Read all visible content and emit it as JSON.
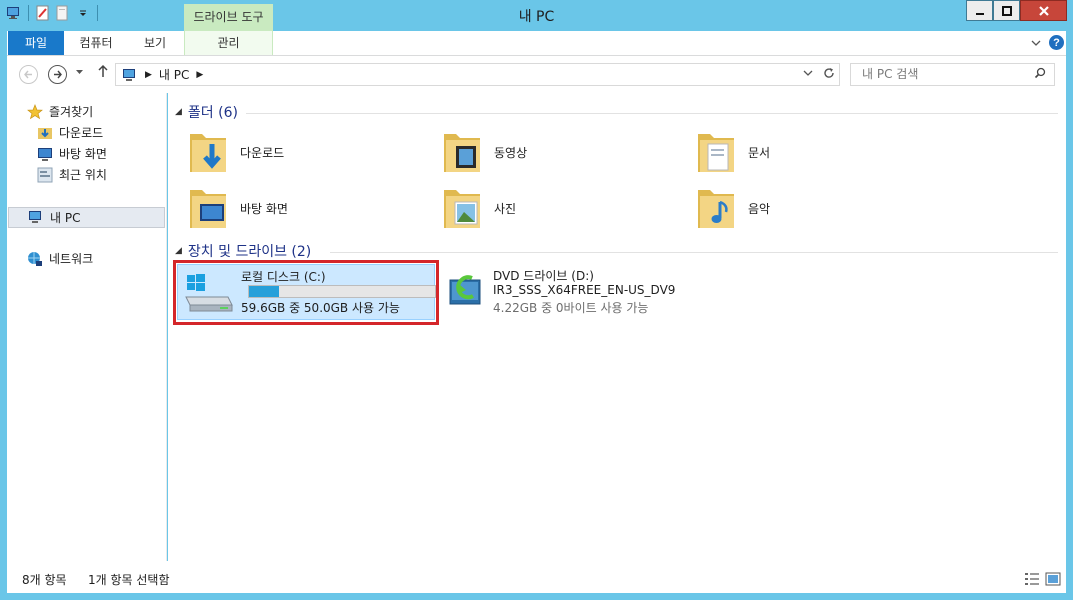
{
  "window": {
    "title": "내 PC",
    "context_tab_header": "드라이브 도구"
  },
  "ribbon": {
    "tabs": [
      "파일",
      "컴퓨터",
      "보기",
      "관리"
    ],
    "help_glyph": "?"
  },
  "address": {
    "crumb": "내 PC",
    "search_placeholder": "내 PC 검색"
  },
  "nav_pane": {
    "favorites_label": "즐겨찾기",
    "favorites": [
      "다운로드",
      "바탕 화면",
      "최근 위치"
    ],
    "this_pc": "내 PC",
    "network": "네트워크"
  },
  "folders_group": {
    "header": "폴더 (6)",
    "items": [
      "다운로드",
      "동영상",
      "문서",
      "바탕 화면",
      "사진",
      "음악"
    ]
  },
  "drives_group": {
    "header": "장치 및 드라이브 (2)",
    "local": {
      "name": "로컬 디스크 (C:)",
      "space": "59.6GB 중 50.0GB 사용 가능",
      "used_fraction": 0.16
    },
    "dvd": {
      "name": "DVD 드라이브 (D:)",
      "label": "IR3_SSS_X64FREE_EN-US_DV9",
      "space": "4.22GB 중 0바이트 사용 가능"
    }
  },
  "status": {
    "items": "8개 항목",
    "selected": "1개 항목 선택함"
  },
  "colors": {
    "frame": "#6ac6e8",
    "file_tab": "#1979ca",
    "context_tab": "#c9eac0",
    "selection": "#cce8ff",
    "highlight_box": "#d4262a",
    "group_header": "#1e3287"
  }
}
